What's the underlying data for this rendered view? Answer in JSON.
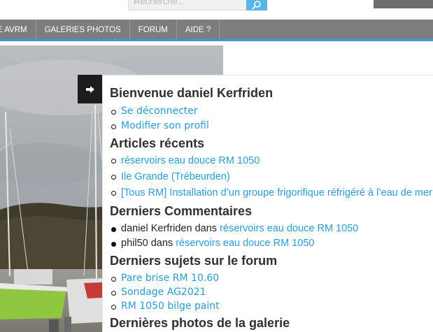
{
  "search": {
    "placeholder": "Recherche..."
  },
  "nav": {
    "items": [
      "E AVRM",
      "GALERIES PHOTOS",
      "FORUM",
      "AIDE ?"
    ]
  },
  "accent": "#3a9bd6",
  "panel": {
    "welcome_title": "Bienvenue daniel Kerfriden",
    "user_links": [
      "Se déconnecter",
      "Modifier son profil"
    ],
    "articles_title": "Articles récents",
    "articles": [
      "réservoirs eau douce RM 1050",
      "Ile Grande (Trébeurden)",
      "[Tous RM] Installation d’un groupe frigorifique réfrigéré à l’eau de mer"
    ],
    "comments_title": "Derniers Commentaires",
    "comments": [
      {
        "author": "daniel Kerfriden",
        "sep": " dans ",
        "post": "réservoirs eau douce RM 1050"
      },
      {
        "author": "phil50",
        "sep": " dans ",
        "post": "réservoirs eau douce RM 1050"
      }
    ],
    "forum_title": "Derniers sujets sur le forum",
    "forum": [
      "Pare brise RM 10.60",
      "Sondage AG2021",
      "RM 1050 bilge paint"
    ],
    "gallery_title": "Dernières photos de la galerie"
  }
}
